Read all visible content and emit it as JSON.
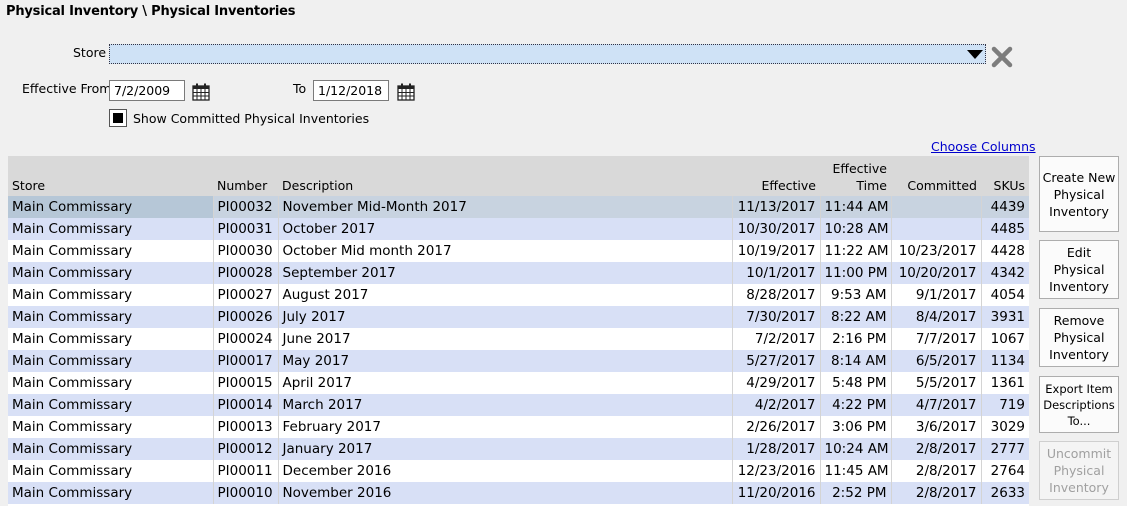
{
  "breadcrumb": "Physical Inventory \\ Physical Inventories",
  "filters": {
    "store_label": "Store",
    "store_value": "",
    "effective_from_label": "Effective From",
    "effective_from": "7/2/2009",
    "to_label": "To",
    "to": "1/12/2018",
    "show_committed_label": "Show Committed Physical Inventories",
    "show_committed_checked": true
  },
  "choose_columns": "Choose Columns",
  "table": {
    "columns": [
      "Store",
      "Number",
      "Description",
      "Effective",
      "Effective\nTime",
      "Committed",
      "SKUs"
    ],
    "rows": [
      [
        "Main Commissary",
        "PI00032",
        "November Mid-Month 2017",
        "11/13/2017",
        "11:44 AM",
        "",
        "4439"
      ],
      [
        "Main Commissary",
        "PI00031",
        "October 2017",
        "10/30/2017",
        "10:28 AM",
        "",
        "4485"
      ],
      [
        "Main Commissary",
        "PI00030",
        "October Mid month 2017",
        "10/19/2017",
        "11:22 AM",
        "10/23/2017",
        "4428"
      ],
      [
        "Main Commissary",
        "PI00028",
        "September 2017",
        "10/1/2017",
        "11:00 PM",
        "10/20/2017",
        "4342"
      ],
      [
        "Main Commissary",
        "PI00027",
        "August 2017",
        "8/28/2017",
        "9:53 AM",
        "9/1/2017",
        "4054"
      ],
      [
        "Main Commissary",
        "PI00026",
        "July 2017",
        "7/30/2017",
        "8:22 AM",
        "8/4/2017",
        "3931"
      ],
      [
        "Main Commissary",
        "PI00024",
        "June 2017",
        "7/2/2017",
        "2:16 PM",
        "7/7/2017",
        "1067"
      ],
      [
        "Main Commissary",
        "PI00017",
        "May 2017",
        "5/27/2017",
        "8:14 AM",
        "6/5/2017",
        "1134"
      ],
      [
        "Main Commissary",
        "PI00015",
        "April 2017",
        "4/29/2017",
        "5:48 PM",
        "5/5/2017",
        "1361"
      ],
      [
        "Main Commissary",
        "PI00014",
        "March 2017",
        "4/2/2017",
        "4:22 PM",
        "4/7/2017",
        "719"
      ],
      [
        "Main Commissary",
        "PI00013",
        "February 2017",
        "2/26/2017",
        "3:06 PM",
        "3/6/2017",
        "3029"
      ],
      [
        "Main Commissary",
        "PI00012",
        "January 2017",
        "1/28/2017",
        "10:24 AM",
        "2/8/2017",
        "2777"
      ],
      [
        "Main Commissary",
        "PI00011",
        "December 2016",
        "12/23/2016",
        "11:45 AM",
        "2/8/2017",
        "2764"
      ],
      [
        "Main Commissary",
        "PI00010",
        "November 2016",
        "11/20/2016",
        "2:52 PM",
        "2/8/2017",
        "2633"
      ]
    ]
  },
  "buttons": {
    "create": "Create New Physical Inventory",
    "edit": "Edit Physical Inventory",
    "remove": "Remove Physical Inventory",
    "export": "Export Item Descriptions To...",
    "uncommit": "Uncommit Physical Inventory"
  },
  "icons": {
    "store_dropdown": "chevron-down-icon",
    "store_clear": "close-icon",
    "date_picker": "calendar-icon"
  }
}
